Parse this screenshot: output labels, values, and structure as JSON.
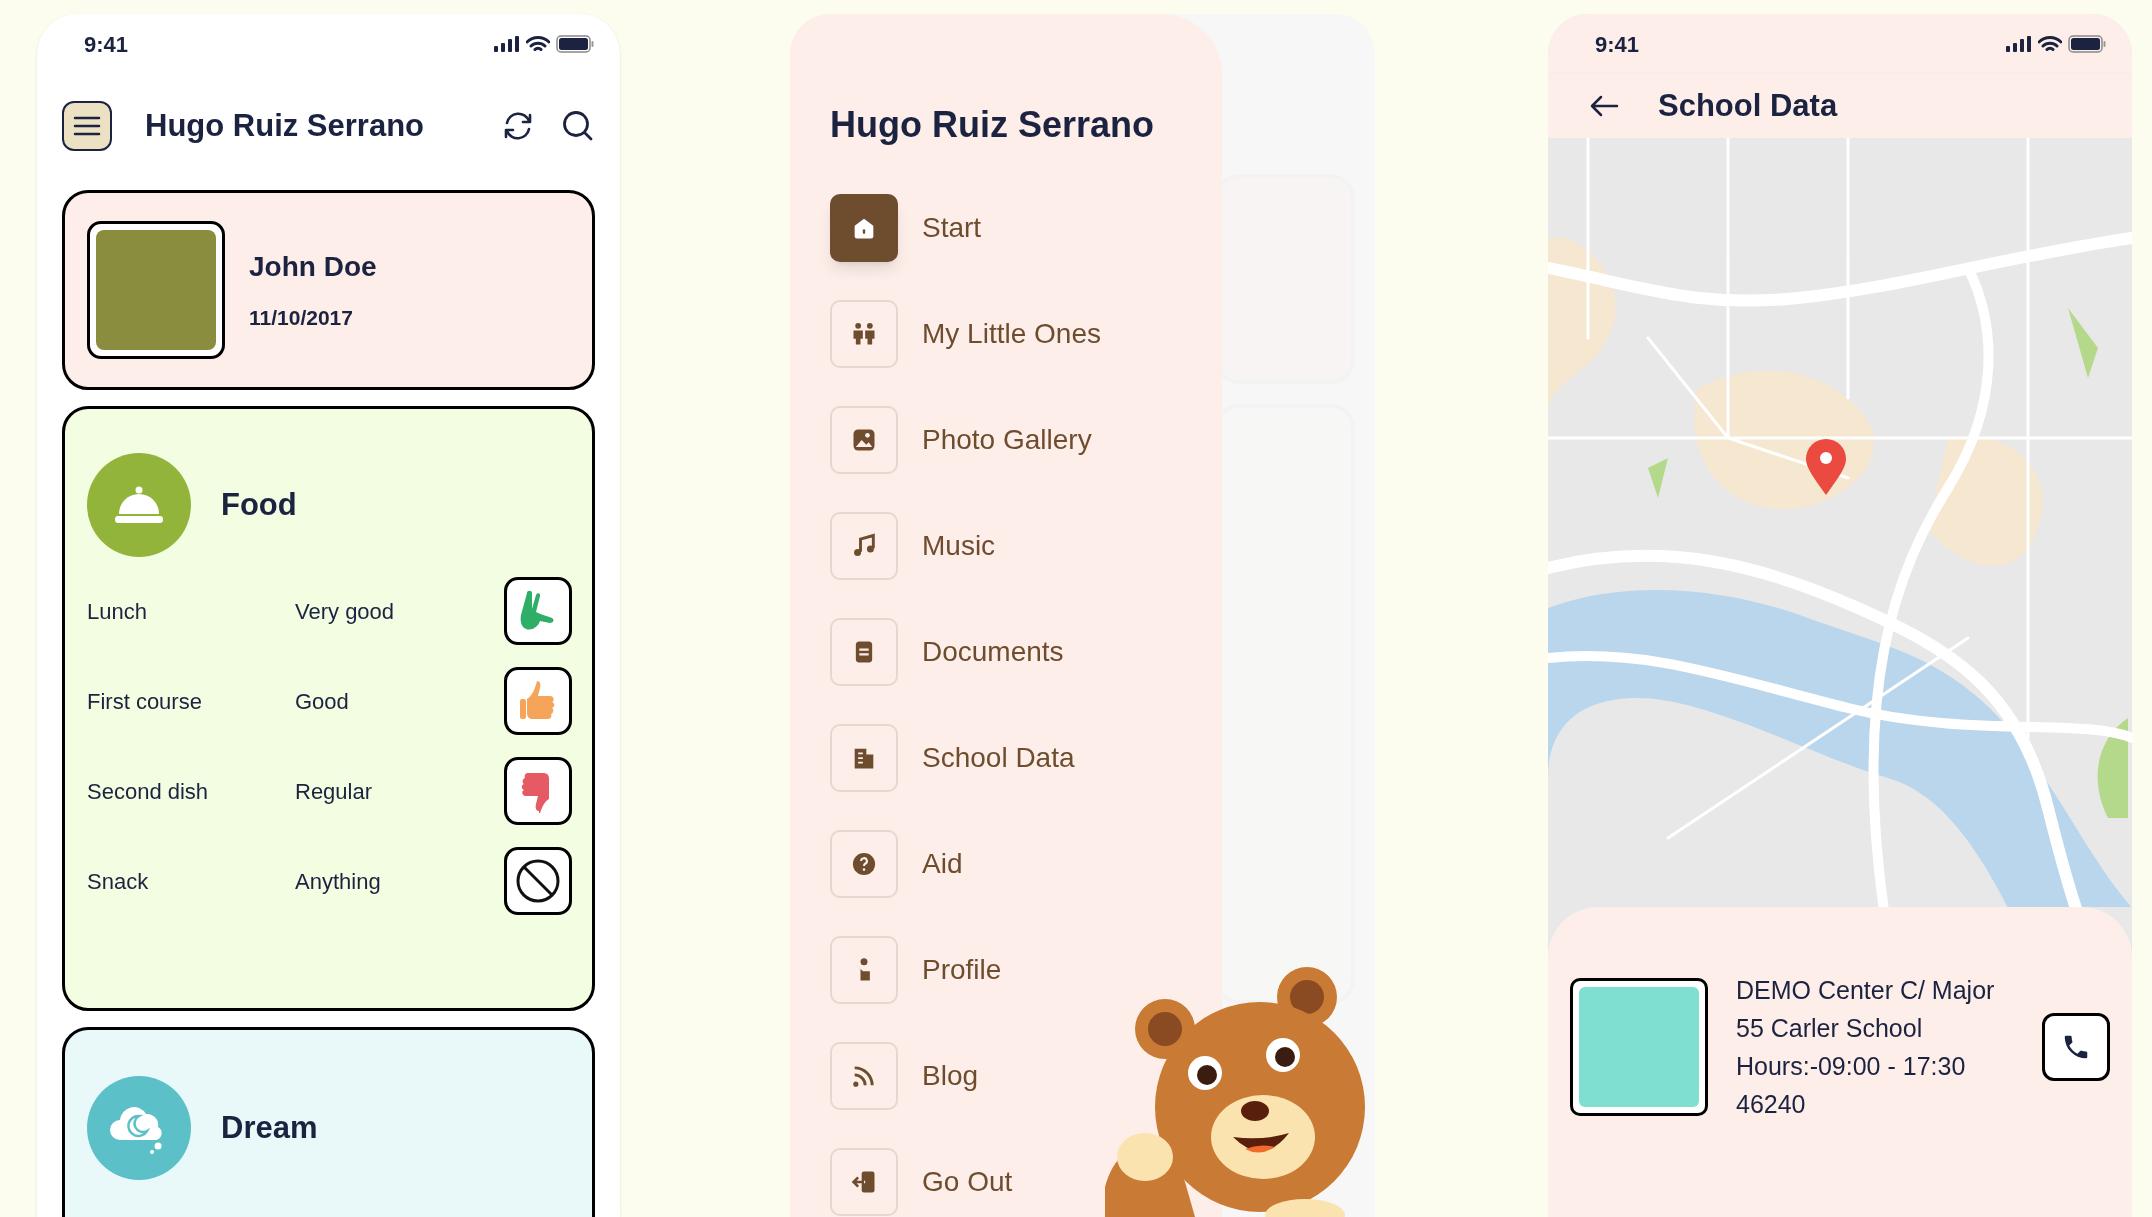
{
  "home_screen": {
    "status_time": "9:41",
    "title": "Hugo Ruiz Serrano",
    "child_card": {
      "name": "John Doe",
      "birthdate": "11/10/2017"
    },
    "food_card": {
      "title": "Food",
      "rows": [
        {
          "meal": "Lunch",
          "rating": "Very good",
          "kind": "very_good"
        },
        {
          "meal": "First course",
          "rating": "Good",
          "kind": "good"
        },
        {
          "meal": "Second dish",
          "rating": "Regular",
          "kind": "regular"
        },
        {
          "meal": "Snack",
          "rating": "Anything",
          "kind": "anything"
        }
      ]
    },
    "dream_card": {
      "title": "Dream"
    }
  },
  "menu_screen": {
    "title": "Hugo Ruiz Serrano",
    "items": [
      {
        "label": "Start",
        "selected": true
      },
      {
        "label": "My Little Ones",
        "selected": false
      },
      {
        "label": "Photo Gallery",
        "selected": false
      },
      {
        "label": "Music",
        "selected": false
      },
      {
        "label": "Documents",
        "selected": false
      },
      {
        "label": "School Data",
        "selected": false
      },
      {
        "label": "Aid",
        "selected": false
      },
      {
        "label": "Profile",
        "selected": false
      },
      {
        "label": "Blog",
        "selected": false
      },
      {
        "label": "Go Out",
        "selected": false
      }
    ]
  },
  "school_screen": {
    "status_time": "9:41",
    "title": "School Data",
    "info_lines": [
      "DEMO Center C/ Major",
      "55 Carler School",
      "Hours:-09:00 - 17:30",
      "46240"
    ]
  }
}
